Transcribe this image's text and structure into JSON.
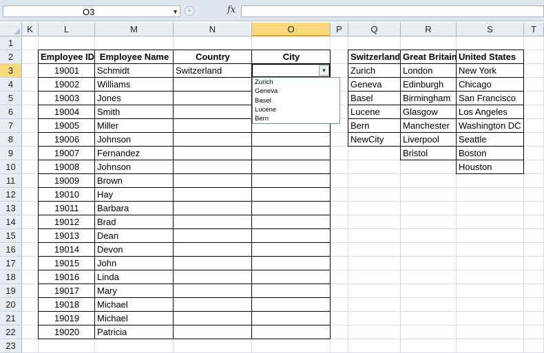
{
  "name_box": "O3",
  "formula_icon": "fx",
  "formula_value": "",
  "columns": [
    "K",
    "L",
    "M",
    "N",
    "O",
    "P",
    "Q",
    "R",
    "S",
    "T"
  ],
  "selected_column": "O",
  "rows": [
    "1",
    "2",
    "3",
    "4",
    "5",
    "6",
    "7",
    "8",
    "9",
    "10",
    "11",
    "12",
    "13",
    "14",
    "15",
    "16",
    "17",
    "18",
    "19",
    "20",
    "21",
    "22",
    "23"
  ],
  "selected_row": "3",
  "employee_table": {
    "headers": [
      "Employee ID",
      "Employee Name",
      "Country",
      "City"
    ],
    "rows": [
      [
        "19001",
        "Schmidt",
        "Switzerland",
        ""
      ],
      [
        "19002",
        "Williams",
        "",
        ""
      ],
      [
        "19003",
        "Jones",
        "",
        ""
      ],
      [
        "19004",
        "Smith",
        "",
        ""
      ],
      [
        "19005",
        "Miller",
        "",
        ""
      ],
      [
        "19006",
        "Johnson",
        "",
        ""
      ],
      [
        "19007",
        "Fernandez",
        "",
        ""
      ],
      [
        "19008",
        "Johnson",
        "",
        ""
      ],
      [
        "19009",
        "Brown",
        "",
        ""
      ],
      [
        "19010",
        "Hay",
        "",
        ""
      ],
      [
        "19011",
        "Barbara",
        "",
        ""
      ],
      [
        "19012",
        "Brad",
        "",
        ""
      ],
      [
        "19013",
        "Dean",
        "",
        ""
      ],
      [
        "19014",
        "Devon",
        "",
        ""
      ],
      [
        "19015",
        "John",
        "",
        ""
      ],
      [
        "19016",
        "Linda",
        "",
        ""
      ],
      [
        "19017",
        "Mary",
        "",
        ""
      ],
      [
        "19018",
        "Michael",
        "",
        ""
      ],
      [
        "19019",
        "Michael",
        "",
        ""
      ],
      [
        "19020",
        "Patricia",
        "",
        ""
      ]
    ]
  },
  "city_lists": {
    "headers": [
      "Switzerland",
      "Great Britain",
      "United States"
    ],
    "columns": [
      [
        "Zurich",
        "Geneva",
        "Basel",
        "Lucene",
        "Bern",
        "NewCity"
      ],
      [
        "London",
        "Edinburgh",
        "Birmingham",
        "Glasgow",
        "Manchester",
        "Liverpool",
        "Bristol"
      ],
      [
        "New York",
        "Chicago",
        "San Francisco",
        "Los Angeles",
        "Washington DC",
        "Seattle",
        "Boston",
        "Houston"
      ]
    ]
  },
  "city_dropdown": {
    "options": [
      "Zurich",
      "Geneva",
      "Basel",
      "Lucene",
      "Bern"
    ]
  }
}
